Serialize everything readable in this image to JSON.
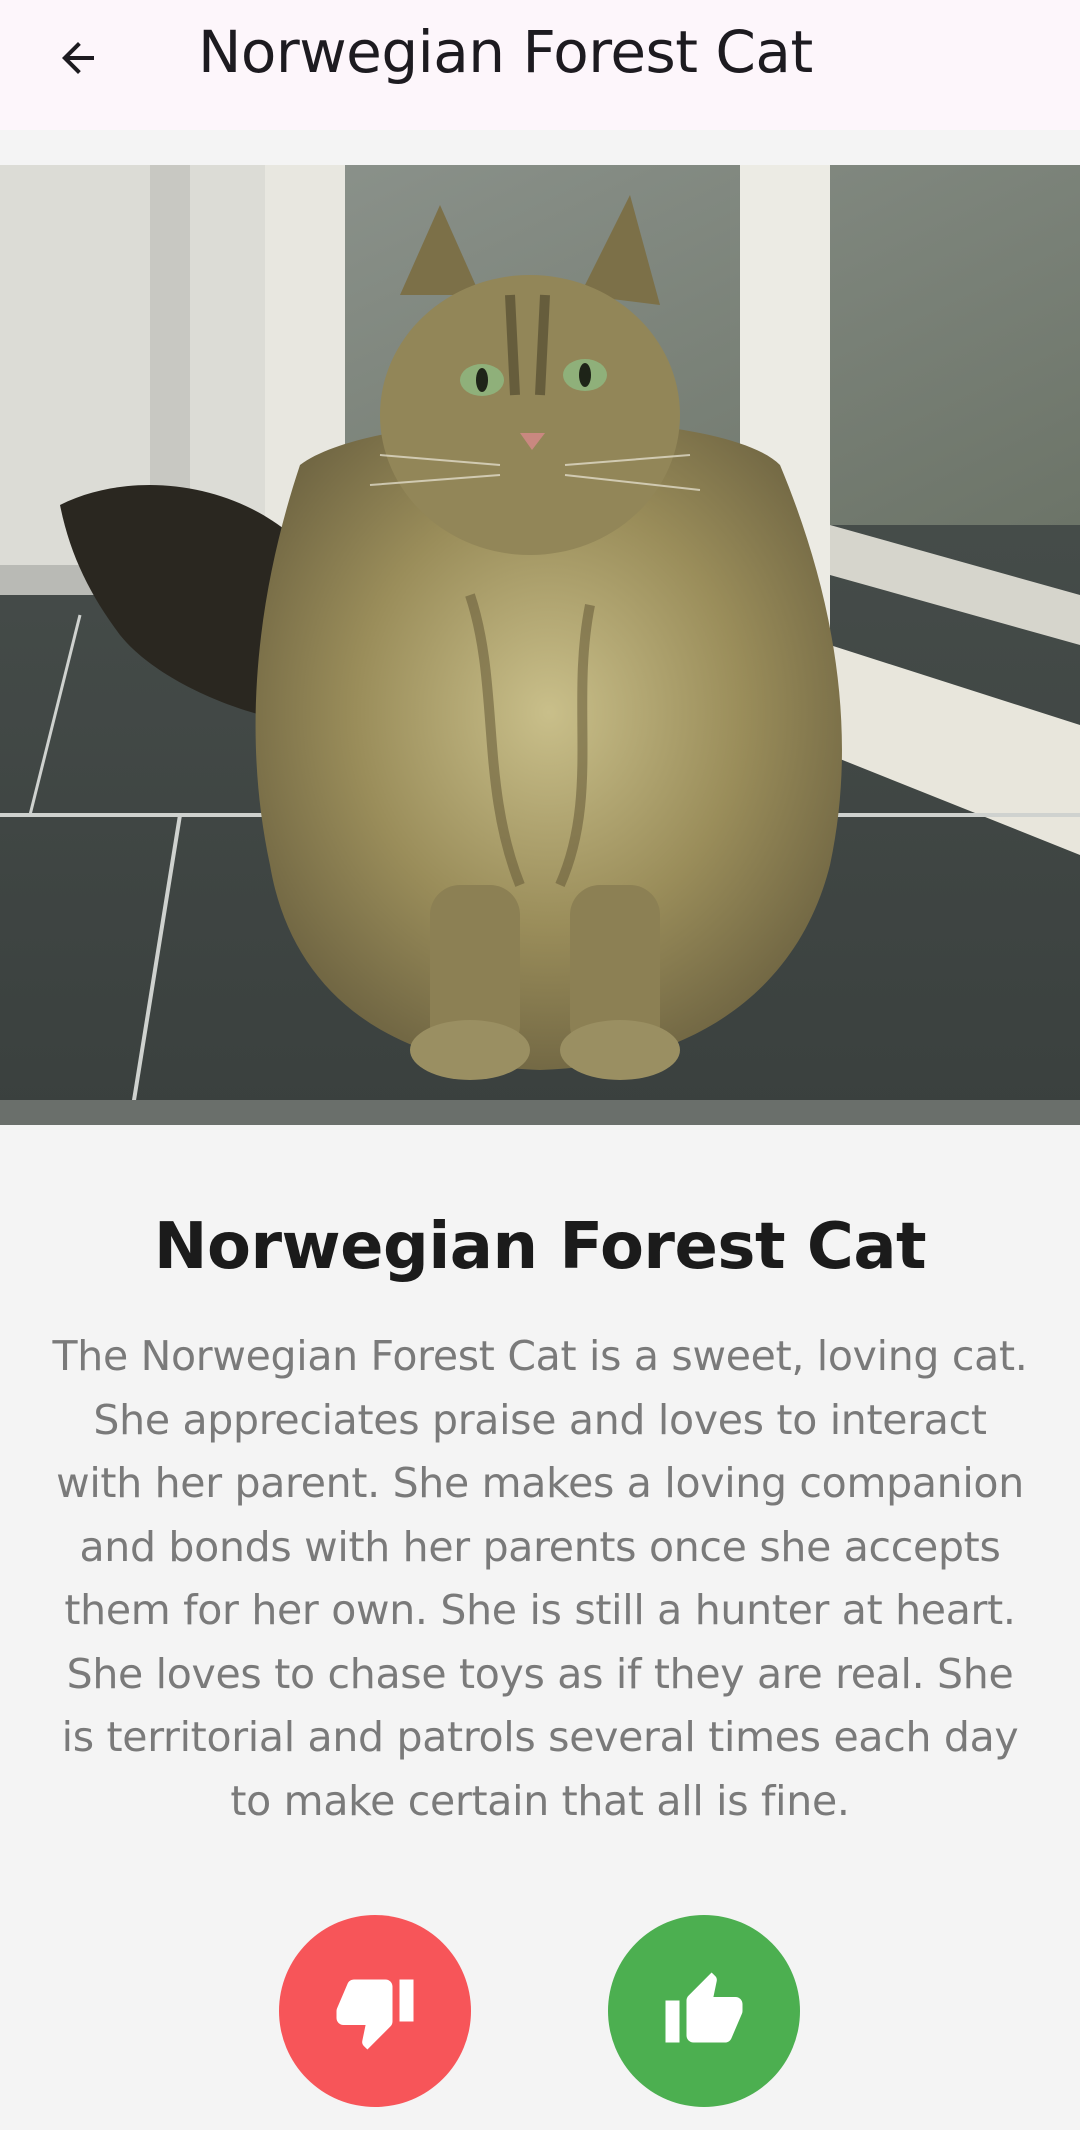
{
  "app_bar": {
    "title": "Norwegian Forest Cat",
    "back_icon": "arrow-left-icon"
  },
  "photo": {
    "subject": "cat-photo"
  },
  "breed": {
    "name": "Norwegian Forest Cat",
    "description": "The Norwegian Forest Cat is a sweet, loving cat. She appreciates praise and loves to interact with her parent. She makes a loving companion and bonds with her parents once she accepts them for her own. She is still a hunter at heart. She loves to chase toys as if they are real. She is territorial and patrols several times each day to make certain that all is fine."
  },
  "actions": {
    "dislike": {
      "icon": "thumbs-down-icon",
      "color": "#f75559"
    },
    "like": {
      "icon": "thumbs-up-icon",
      "color": "#4caf50"
    }
  }
}
